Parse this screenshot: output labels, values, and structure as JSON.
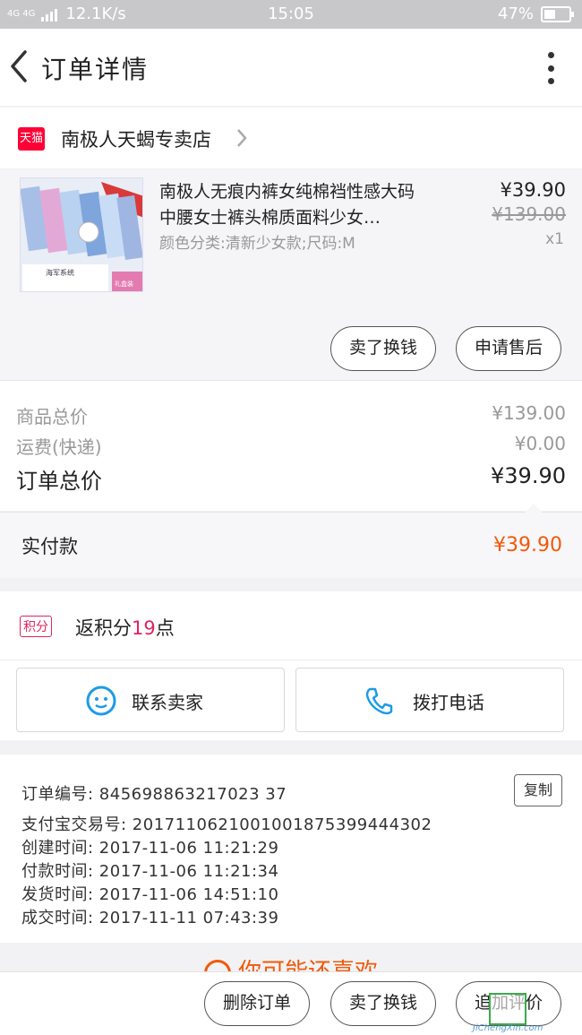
{
  "status": {
    "network": "4G 4G",
    "speed": "12.1K/s",
    "time": "15:05",
    "battery": "47%",
    "battery_level": 0.47
  },
  "nav": {
    "title": "订单详情"
  },
  "shop": {
    "badge": "天猫",
    "name": "南极人天蝎专卖店"
  },
  "item": {
    "title": "南极人无痕内裤女纯棉裆性感大码中腰女士裤头棉质面料少女…",
    "sku": "颜色分类:清新少女款;尺码:M",
    "price": "¥39.90",
    "original_price": "¥139.00",
    "quantity": "x1",
    "thumb_label": "海军系统",
    "thumb_tag": "礼盒装",
    "actions": {
      "sell": "卖了换钱",
      "after_sale": "申请售后"
    }
  },
  "summary": {
    "goods_total_label": "商品总价",
    "goods_total": "¥139.00",
    "shipping_label": "运费(快递)",
    "shipping": "¥0.00",
    "order_total_label": "订单总价",
    "order_total": "¥39.90"
  },
  "paid": {
    "label": "实付款",
    "value": "¥39.90"
  },
  "points": {
    "badge": "积分",
    "prefix": "返积分",
    "value": "19",
    "suffix": "点"
  },
  "contact": {
    "seller": "联系卖家",
    "call": "拨打电话"
  },
  "info": {
    "order_no": "订单编号: 845698863217023 37",
    "copy": "复制",
    "alipay_no": "支付宝交易号: 2017110621001001875399444302",
    "created": "创建时间: 2017-11-06  11:21:29",
    "paid": "付款时间: 2017-11-06  11:21:34",
    "shipped": "发货时间: 2017-11-06  14:51:10",
    "completed": "成交时间: 2017-11-11  07:43:39"
  },
  "recommend": {
    "title": "你可能还喜欢"
  },
  "bottom": {
    "delete": "删除订单",
    "sell": "卖了换钱",
    "review": "追加评价"
  },
  "watermark": {
    "site": "JiChengXin.com"
  },
  "colors": {
    "accent": "#f05a0a",
    "tmall": "#ff0036",
    "points": "#e0245e",
    "icon_blue": "#1e9be6"
  }
}
